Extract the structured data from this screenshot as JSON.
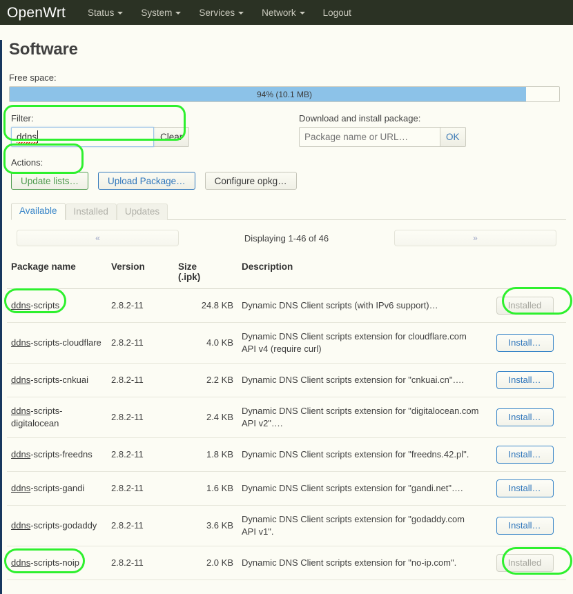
{
  "topbar": {
    "brand": "OpenWrt",
    "menu": [
      {
        "label": "Status",
        "has_caret": true
      },
      {
        "label": "System",
        "has_caret": true
      },
      {
        "label": "Services",
        "has_caret": true
      },
      {
        "label": "Network",
        "has_caret": true
      },
      {
        "label": "Logout",
        "has_caret": false
      }
    ]
  },
  "page": {
    "title": "Software",
    "free_space_label": "Free space:",
    "free_space_percent": 94,
    "free_space_text": "94% (10.1 MB)"
  },
  "filter": {
    "label": "Filter:",
    "value": "ddns",
    "clear_label": "Clear"
  },
  "download": {
    "label": "Download and install package:",
    "placeholder": "Package name or URL…",
    "ok_label": "OK"
  },
  "actions": {
    "label": "Actions:",
    "update_lists": "Update lists…",
    "upload_package": "Upload Package…",
    "configure_opkg": "Configure opkg…"
  },
  "tabs": [
    {
      "label": "Available",
      "active": true
    },
    {
      "label": "Installed",
      "active": false
    },
    {
      "label": "Updates",
      "active": false
    }
  ],
  "pager": {
    "prev": "«",
    "next": "»",
    "info": "Displaying 1-46 of 46"
  },
  "table": {
    "headers": {
      "name": "Package name",
      "version": "Version",
      "size_line1": "Size",
      "size_line2": "(.ipk)",
      "description": "Description",
      "action": ""
    },
    "rows": [
      {
        "match": "ddns",
        "name_rest": "-scripts",
        "version": "2.8.2-11",
        "size": "24.8 KB",
        "description": "Dynamic DNS Client scripts (with IPv6 support)…",
        "action": "Installed",
        "installed": true
      },
      {
        "match": "ddns",
        "name_rest": "-scripts-cloudflare",
        "version": "2.8.2-11",
        "size": "4.0 KB",
        "description": "Dynamic DNS Client scripts extension for cloudflare.com API v4 (require curl)",
        "action": "Install…",
        "installed": false
      },
      {
        "match": "ddns",
        "name_rest": "-scripts-cnkuai",
        "version": "2.8.2-11",
        "size": "2.2 KB",
        "description": "Dynamic DNS Client scripts extension for \"cnkuai.cn\"….",
        "action": "Install…",
        "installed": false
      },
      {
        "match": "ddns",
        "name_rest": "-scripts-digitalocean",
        "version": "2.8.2-11",
        "size": "2.4 KB",
        "description": "Dynamic DNS Client scripts extension for \"digitalocean.com API v2\"….",
        "action": "Install…",
        "installed": false
      },
      {
        "match": "ddns",
        "name_rest": "-scripts-freedns",
        "version": "2.8.2-11",
        "size": "1.8 KB",
        "description": "Dynamic DNS Client scripts extension for \"freedns.42.pl\".",
        "action": "Install…",
        "installed": false
      },
      {
        "match": "ddns",
        "name_rest": "-scripts-gandi",
        "version": "2.8.2-11",
        "size": "1.6 KB",
        "description": "Dynamic DNS Client scripts extension for \"gandi.net\"….",
        "action": "Install…",
        "installed": false
      },
      {
        "match": "ddns",
        "name_rest": "-scripts-godaddy",
        "version": "2.8.2-11",
        "size": "3.6 KB",
        "description": "Dynamic DNS Client scripts extension for \"godaddy.com API v1\".",
        "action": "Install…",
        "installed": false
      },
      {
        "match": "ddns",
        "name_rest": "-scripts-noip",
        "version": "2.8.2-11",
        "size": "2.0 KB",
        "description": "Dynamic DNS Client scripts extension for \"no-ip.com\".",
        "action": "Installed",
        "installed": true
      }
    ]
  },
  "colors": {
    "annotation_green": "#2ef02e",
    "navbar_bg": "#2b3224",
    "page_bg": "#fcfcf4",
    "progress_fill": "#8cc2e8",
    "link_blue": "#3a86c8",
    "accent_border": "#17375e"
  }
}
